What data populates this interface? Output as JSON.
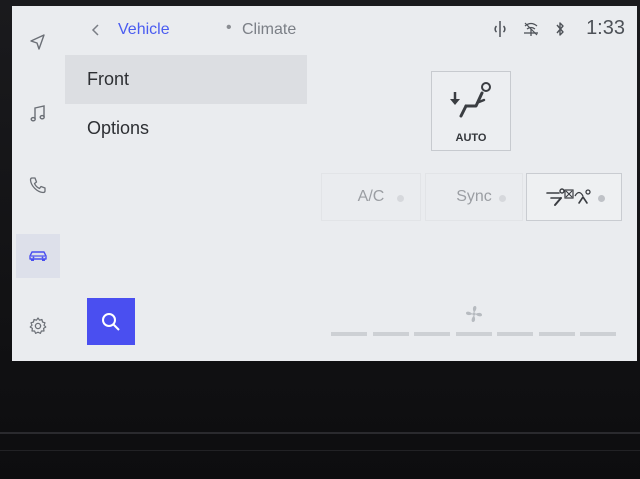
{
  "header": {
    "breadcrumb_parent": "Vehicle",
    "breadcrumb_separator": "•",
    "breadcrumb_current": "Climate",
    "back_icon": "chevron-left-icon"
  },
  "status_bar": {
    "icons": [
      "wireless-charging-icon",
      "no-signal-icon",
      "bluetooth-icon"
    ],
    "time": "1:33"
  },
  "rail": {
    "items": [
      "navigation-icon",
      "music-icon",
      "phone-icon",
      "vehicle-icon",
      "settings-icon"
    ],
    "active": "vehicle-icon"
  },
  "menu": {
    "items": [
      {
        "label": "Front",
        "selected": true
      },
      {
        "label": "Options",
        "selected": false
      }
    ],
    "search_icon": "search-icon"
  },
  "climate": {
    "auto_label": "AUTO",
    "ac_label": "A/C",
    "sync_label": "Sync",
    "recirc_icon": "air-recirculation-icon",
    "fan_icon": "fan-icon",
    "fan_level": 0,
    "fan_levels_total": 7
  },
  "colors": {
    "accent": "#4a4ff0",
    "link": "#4a5cf0",
    "screen_bg": "#eaecef"
  }
}
